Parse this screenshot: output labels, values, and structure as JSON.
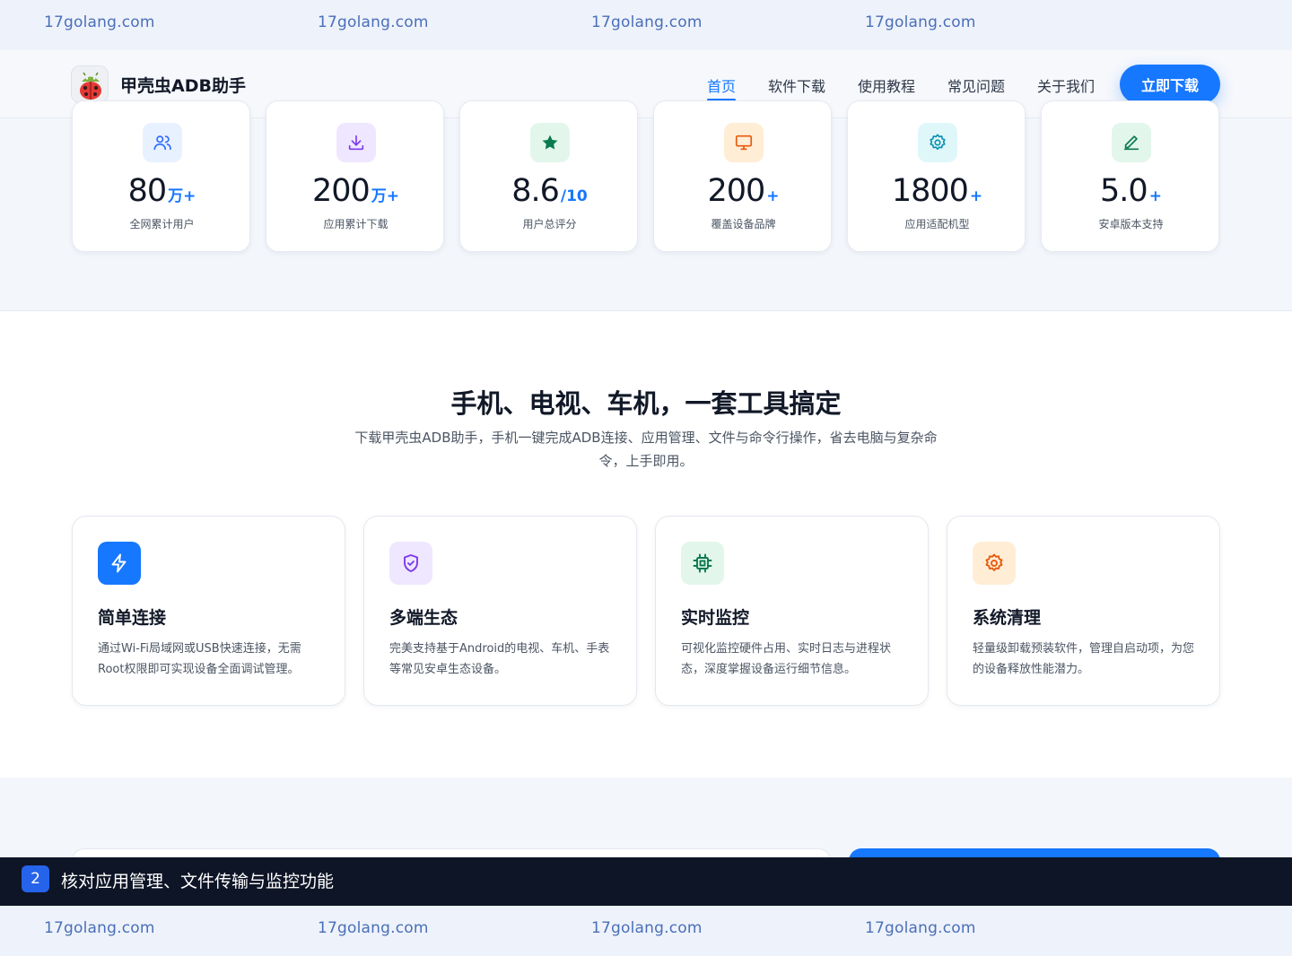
{
  "watermark": {
    "text": "17golang.com"
  },
  "nav": {
    "brand": "甲壳虫ADB助手",
    "links": [
      "首页",
      "软件下载",
      "使用教程",
      "常见问题",
      "关于我们"
    ],
    "active_index": 0,
    "cta": "立即下载"
  },
  "stats": [
    {
      "value": "80",
      "unit": "万+",
      "label": "全网累计用户",
      "icon": "users-icon",
      "color": "#2f6bff",
      "bg": "#e8f1ff"
    },
    {
      "value": "200",
      "unit": "万+",
      "label": "应用累计下载",
      "icon": "download-icon",
      "color": "#7c3aed",
      "bg": "#efe7ff"
    },
    {
      "value": "8.6",
      "unit": "/10",
      "label": "用户总评分",
      "icon": "star-icon",
      "color": "#0a7a4f",
      "bg": "#e3f6ec"
    },
    {
      "value": "200",
      "unit": "+",
      "label": "覆盖设备品牌",
      "icon": "monitor-icon",
      "color": "#e8590c",
      "bg": "#ffedd5"
    },
    {
      "value": "1800",
      "unit": "+",
      "label": "应用适配机型",
      "icon": "settings-icon",
      "color": "#0891b2",
      "bg": "#e0f7fa"
    },
    {
      "value": "5.0",
      "unit": "+",
      "label": "安卓版本支持",
      "icon": "edit-icon",
      "color": "#0a7a4f",
      "bg": "#e3f6ec"
    }
  ],
  "features_section": {
    "title": "手机、电视、车机，一套工具搞定",
    "subtitle": "下载甲壳虫ADB助手，手机一键完成ADB连接、应用管理、文件与命令行操作，省去电脑与复杂命令，上手即用。"
  },
  "features": [
    {
      "title": "简单连接",
      "desc": "通过Wi-Fi局域网或USB快速连接，无需Root权限即可实现设备全面调试管理。",
      "icon": "lightning-icon",
      "color": "#ffffff",
      "bg": "#1677ff"
    },
    {
      "title": "多端生态",
      "desc": "完美支持基于Android的电视、车机、手表等常见安卓生态设备。",
      "icon": "shield-icon",
      "color": "#7c3aed",
      "bg": "#efe7ff"
    },
    {
      "title": "实时监控",
      "desc": "可视化监控硬件占用、实时日志与进程状态，深度掌握设备运行细节信息。",
      "icon": "chip-icon",
      "color": "#0a7a4f",
      "bg": "#e3f6ec"
    },
    {
      "title": "系统清理",
      "desc": "轻量级卸载预装软件，管理自启动项，为您的设备释放性能潜力。",
      "icon": "gear-icon",
      "color": "#e8590c",
      "bg": "#ffedd5"
    }
  ],
  "task": {
    "step": "2",
    "text": "核对应用管理、文件传输与监控功能"
  }
}
